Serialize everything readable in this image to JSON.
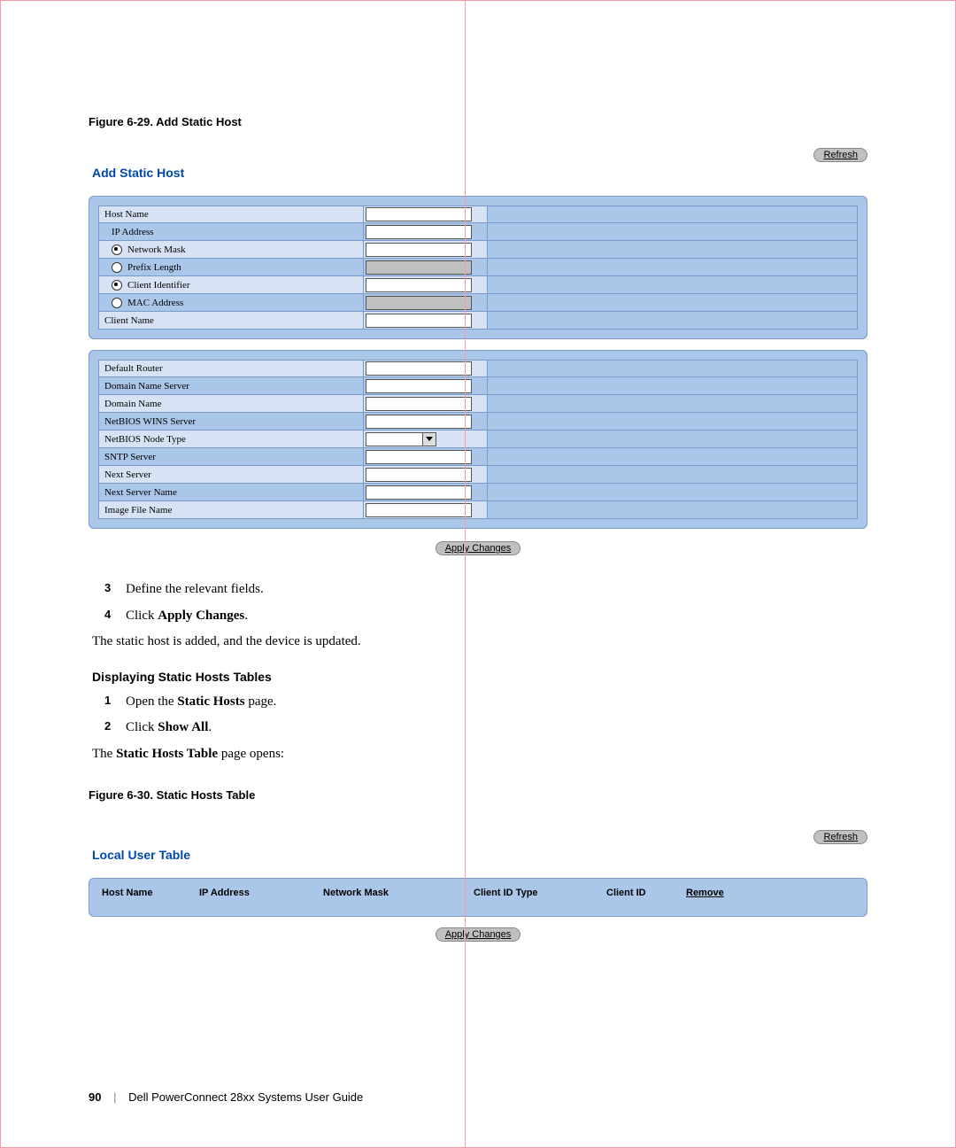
{
  "figure1": {
    "label": "Figure 6-29.    Add Static Host"
  },
  "refresh_label": "Refresh",
  "form_title": "Add Static Host",
  "group1": {
    "rows": [
      {
        "label": "Host Name",
        "type": "text"
      },
      {
        "label": "IP Address",
        "type": "text",
        "indent": true
      },
      {
        "label": "Network Mask",
        "type": "text",
        "radio": true,
        "checked": true,
        "indent": true
      },
      {
        "label": "Prefix Length",
        "type": "text",
        "radio": true,
        "checked": false,
        "disabled": true,
        "indent": true
      },
      {
        "label": "Client Identifier",
        "type": "text",
        "radio": true,
        "checked": true,
        "indent": true
      },
      {
        "label": "MAC Address",
        "type": "text",
        "radio": true,
        "checked": false,
        "disabled": true,
        "indent": true
      },
      {
        "label": "Client Name",
        "type": "text"
      }
    ]
  },
  "group2": {
    "rows": [
      {
        "label": "Default Router",
        "type": "text"
      },
      {
        "label": "Domain Name Server",
        "type": "text"
      },
      {
        "label": "Domain Name",
        "type": "text"
      },
      {
        "label": "NetBIOS WINS Server",
        "type": "text"
      },
      {
        "label": "NetBIOS Node Type",
        "type": "select"
      },
      {
        "label": "SNTP Server",
        "type": "text"
      },
      {
        "label": "Next Server",
        "type": "text"
      },
      {
        "label": "Next Server Name",
        "type": "text"
      },
      {
        "label": "Image File Name",
        "type": "text"
      }
    ]
  },
  "apply_label": "Apply Changes",
  "steps_a": [
    {
      "n": "3",
      "text_pre": "Define the relevant fields."
    },
    {
      "n": "4",
      "text_pre": "Click ",
      "bold": "Apply Changes",
      "text_post": "."
    }
  ],
  "result_a": "The static host is added, and the device is updated.",
  "subhead": "Displaying Static Hosts Tables",
  "steps_b": [
    {
      "n": "1",
      "text_pre": "Open the ",
      "bold": "Static Hosts",
      "text_post": " page."
    },
    {
      "n": "2",
      "text_pre": "Click ",
      "bold": "Show All",
      "text_post": "."
    }
  ],
  "result_b_pre": "The ",
  "result_b_bold": "Static Hosts Table",
  "result_b_post": " page opens:",
  "figure2": {
    "label": "Figure 6-30.    Static Hosts Table"
  },
  "table_title": "Local User Table",
  "table_cols": [
    "Host Name",
    "IP Address",
    "Network Mask",
    "Client ID Type",
    "Client ID",
    "Remove"
  ],
  "footer": {
    "page": "90",
    "title": "Dell PowerConnect 28xx Systems User Guide"
  }
}
